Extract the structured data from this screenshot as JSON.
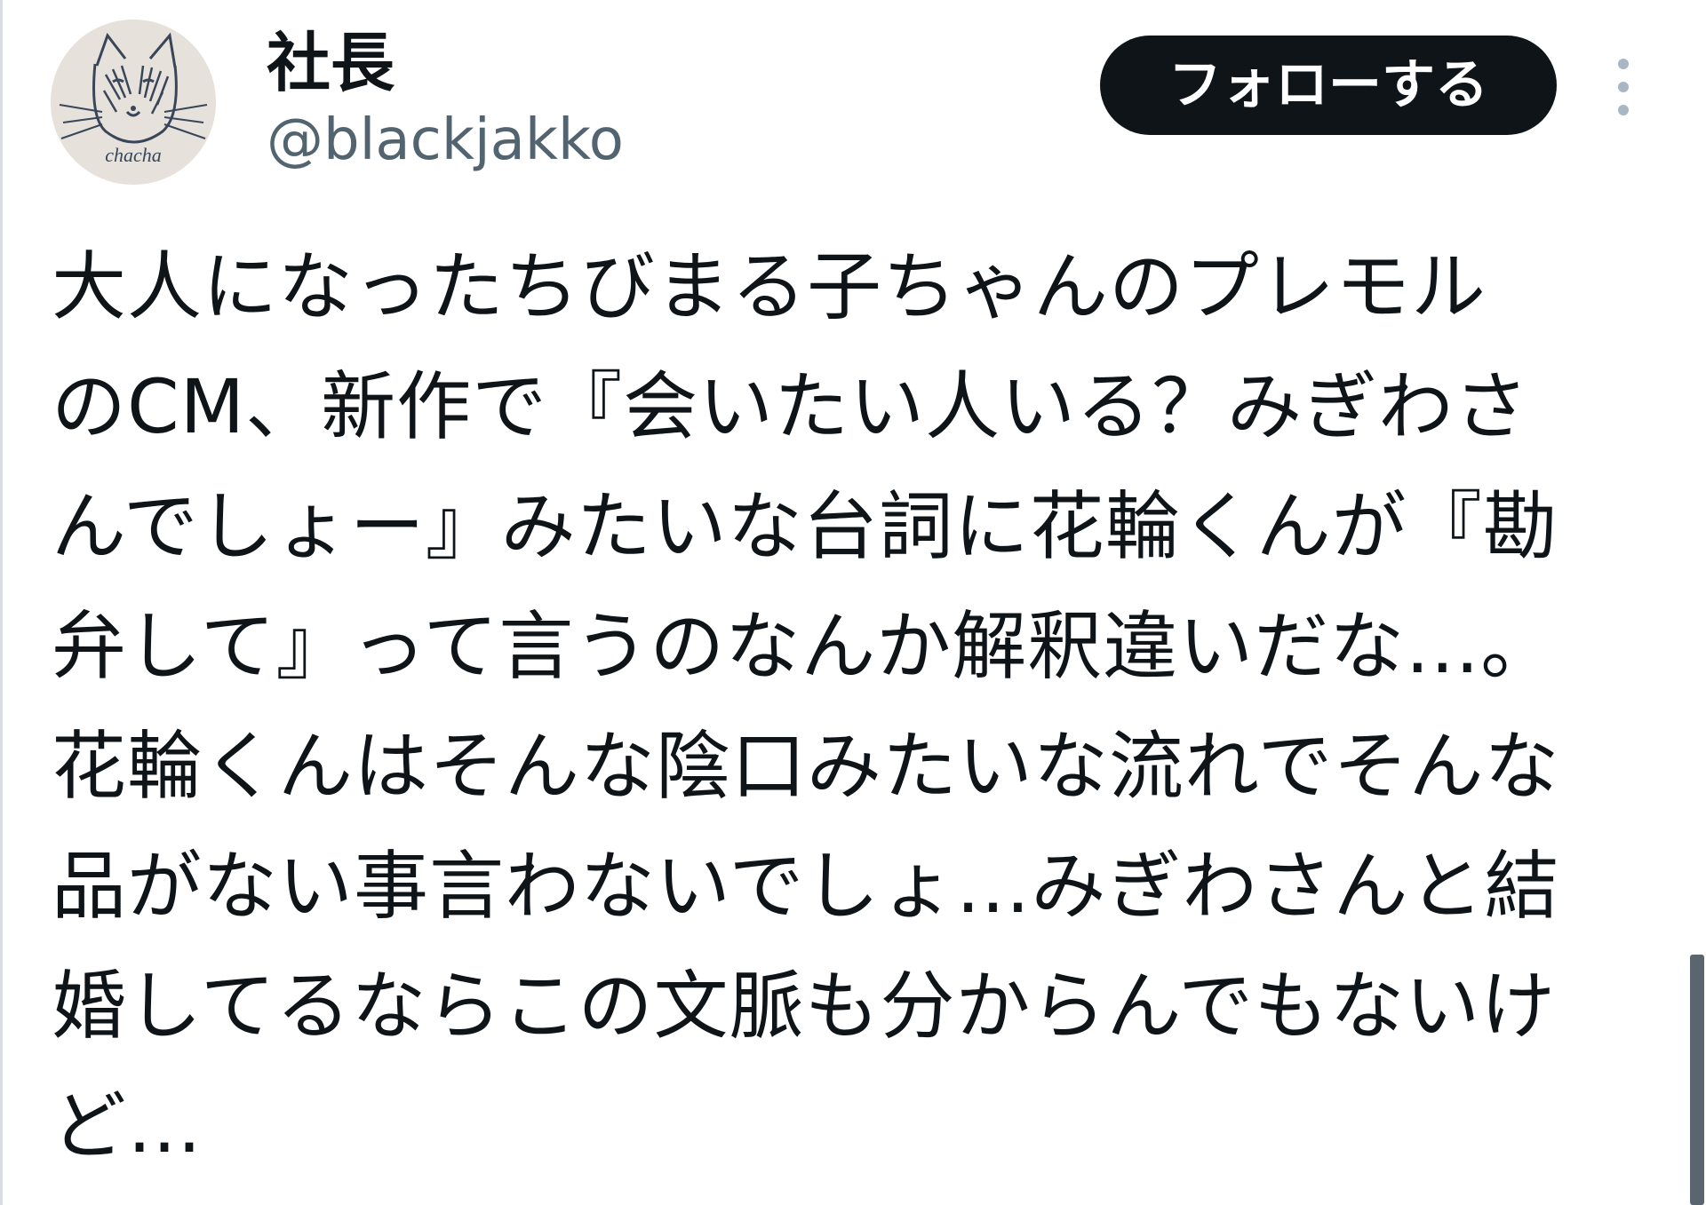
{
  "tweet": {
    "display_name": "社長",
    "handle": "@blackjakko",
    "avatar_text": "chacha",
    "follow_label": "フォローする",
    "more_icon": "more-vertical-icon",
    "body_lines": [
      "大人になったちびまる子ちゃんのプレモル",
      "のCM、新作で『会いたい人いる？みぎわさ",
      "んでしょー』みたいな台詞に花輪くんが『勘",
      "弁して』って言うのなんか解釈違いだな…。",
      "花輪くんはそんな陰口みたいな流れでそんな",
      "品がない事言わないでしょ…みぎわさんと結",
      "婚してるならこの文脈も分からんでもないけ",
      "ど…"
    ]
  },
  "colors": {
    "text_primary": "#0f1419",
    "text_secondary": "#536471",
    "follow_bg": "#0f1419",
    "follow_text": "#ffffff",
    "more_icon": "#a9b7c4"
  }
}
